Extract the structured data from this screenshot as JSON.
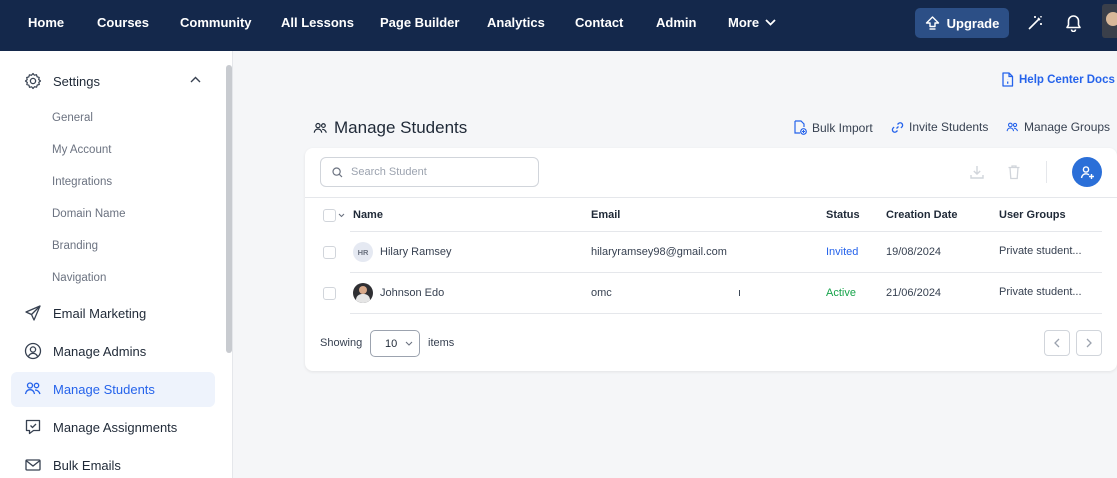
{
  "nav": {
    "items": [
      "Home",
      "Courses",
      "Community",
      "All Lessons",
      "Page Builder",
      "Analytics",
      "Contact",
      "Admin"
    ],
    "more_label": "More",
    "upgrade_label": "Upgrade"
  },
  "sidebar": {
    "settings_label": "Settings",
    "settings_sub": [
      "General",
      "My Account",
      "Integrations",
      "Domain Name",
      "Branding",
      "Navigation"
    ],
    "items": [
      {
        "label": "Email Marketing",
        "icon": "send-icon"
      },
      {
        "label": "Manage Admins",
        "icon": "admin-user-icon"
      },
      {
        "label": "Manage Students",
        "icon": "students-icon",
        "active": true
      },
      {
        "label": "Manage Assignments",
        "icon": "assignment-icon"
      },
      {
        "label": "Bulk Emails",
        "icon": "mail-icon"
      }
    ]
  },
  "main": {
    "help_link": "Help Center Docs",
    "title": "Manage Students",
    "actions": {
      "bulk_import": "Bulk Import",
      "invite_students": "Invite Students",
      "manage_groups": "Manage Groups"
    },
    "search_placeholder": "Search Student",
    "table": {
      "columns": [
        "Name",
        "Email",
        "Status",
        "Creation Date",
        "User Groups"
      ],
      "rows": [
        {
          "initials": "HR",
          "name": "Hilary Ramsey",
          "email": "hilaryramsey98@gmail.com",
          "status": "Invited",
          "creation_date": "19/08/2024",
          "user_groups": "Private student..."
        },
        {
          "initials": "",
          "name": "Johnson Edo",
          "email": "omc",
          "email_tail": "ı",
          "status": "Active",
          "creation_date": "21/06/2024",
          "user_groups": "Private student..."
        }
      ]
    },
    "pagination": {
      "showing_label": "Showing",
      "page_size": "10",
      "items_label": "items"
    }
  },
  "colors": {
    "nav_bg": "#14284b",
    "accent": "#2b6fd8",
    "status_invited": "#2563eb",
    "status_active": "#16a34a"
  }
}
